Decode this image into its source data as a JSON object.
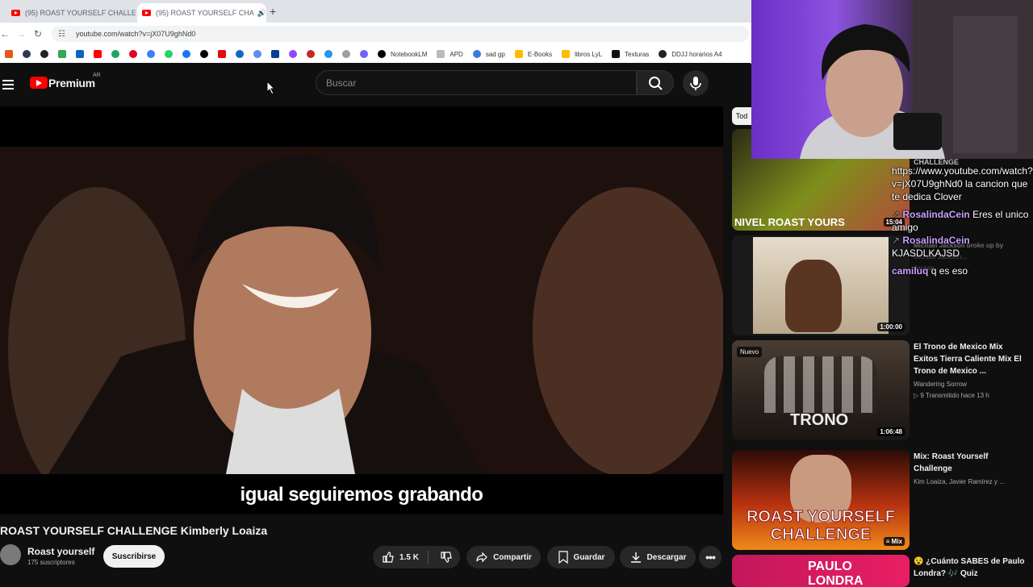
{
  "browser": {
    "tabs": [
      {
        "title": "(95) ROAST YOURSELF CHALLE",
        "active": false
      },
      {
        "title": "(95) ROAST YOURSELF CHA",
        "active": true
      }
    ],
    "url": "youtube.com/watch?v=jX07U9ghNd0",
    "bookmarks": [
      "NotebookLM",
      "APD",
      "sad gp",
      "E-Books",
      "libros LyL",
      "Texturas",
      "DDJJ horarios A4"
    ]
  },
  "header": {
    "logo_text": "Premium",
    "country": "AR",
    "search_placeholder": "Buscar"
  },
  "video": {
    "subtitle": "igual seguiremos grabando",
    "title": "ROAST YOURSELF CHALLENGE Kimberly Loaiza",
    "channel": "Roast yourself",
    "subscribers": "175 suscriptores",
    "subscribe_label": "Suscribirse",
    "likes": "1.5 K",
    "share_label": "Compartir",
    "save_label": "Guardar",
    "download_label": "Descargar"
  },
  "sidebar": {
    "chip_label": "Tod",
    "items": [
      {
        "thumb_text": "NIVEL ROAST YOURS",
        "duration": "15:04",
        "title": "",
        "channel": "",
        "meta": ""
      },
      {
        "thumb_text": "",
        "duration": "1:00:00",
        "title": "Michael Jackson broke up by",
        "channel": "Michael Jackson...",
        "meta": "Jousse"
      },
      {
        "thumb_text": "TRONO",
        "badge": "Nuevo",
        "duration": "1:06:48",
        "title": "El Trono de Mexico Mix Exitos Tierra Caliente Mix El Trono de Mexico ...",
        "channel": "Wandering Sorrow",
        "meta": "9 Transmitido hace 13 h"
      },
      {
        "thumb_text": "ROAST YOURSELF CHALLENGE",
        "duration": "Mix",
        "title": "Mix: Roast Yourself Challenge",
        "channel": "Kim Loaiza, Javier Ramírez y ...",
        "meta": ""
      },
      {
        "thumb_text": "PAULO LONDRA",
        "duration": "",
        "title": "😵 ¿Cuánto SABES de Paulo Londra? 🎶 Quiz",
        "channel": "",
        "meta": ""
      }
    ]
  },
  "overlay": {
    "challenge_label": "CHALLENGE",
    "chat": [
      {
        "user": "",
        "text": "https://www.youtube.com/watch?v=jX07U9ghNd0 la cancion que te dedica Clover"
      },
      {
        "user": "RosalindaCein",
        "text": "Eres el unico amigo"
      },
      {
        "user": "RosalindaCein",
        "text": "KJASDLKAJSD"
      },
      {
        "user": "camiluq",
        "text": "q es eso"
      }
    ]
  },
  "colors": {
    "youtube_red": "#ff0000",
    "background": "#0f0f0f",
    "chat_user": "#c9a0ff"
  }
}
